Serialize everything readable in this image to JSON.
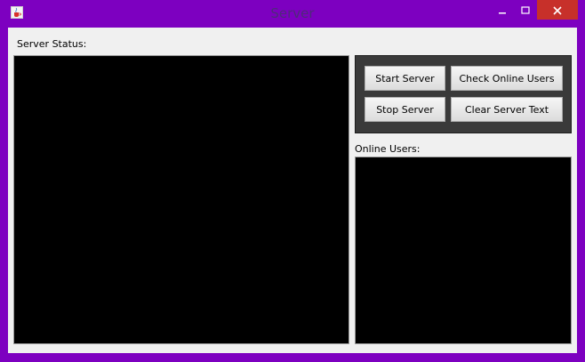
{
  "window": {
    "title": "Server"
  },
  "labels": {
    "server_status": "Server Status:",
    "online_users": "Online Users:"
  },
  "buttons": {
    "start_server": "Start Server",
    "check_online_users": "Check Online Users",
    "stop_server": "Stop Server",
    "clear_server_text": "Clear Server Text"
  },
  "icons": {
    "app": "java-cup-icon",
    "minimize": "minimize-icon",
    "maximize": "maximize-icon",
    "close": "close-icon"
  },
  "colors": {
    "frame": "#7d00c0",
    "close_button": "#c7302a",
    "text_area_background": "#000000",
    "control_panel": "#3a3a3a",
    "client_background": "#f0f0f0"
  }
}
